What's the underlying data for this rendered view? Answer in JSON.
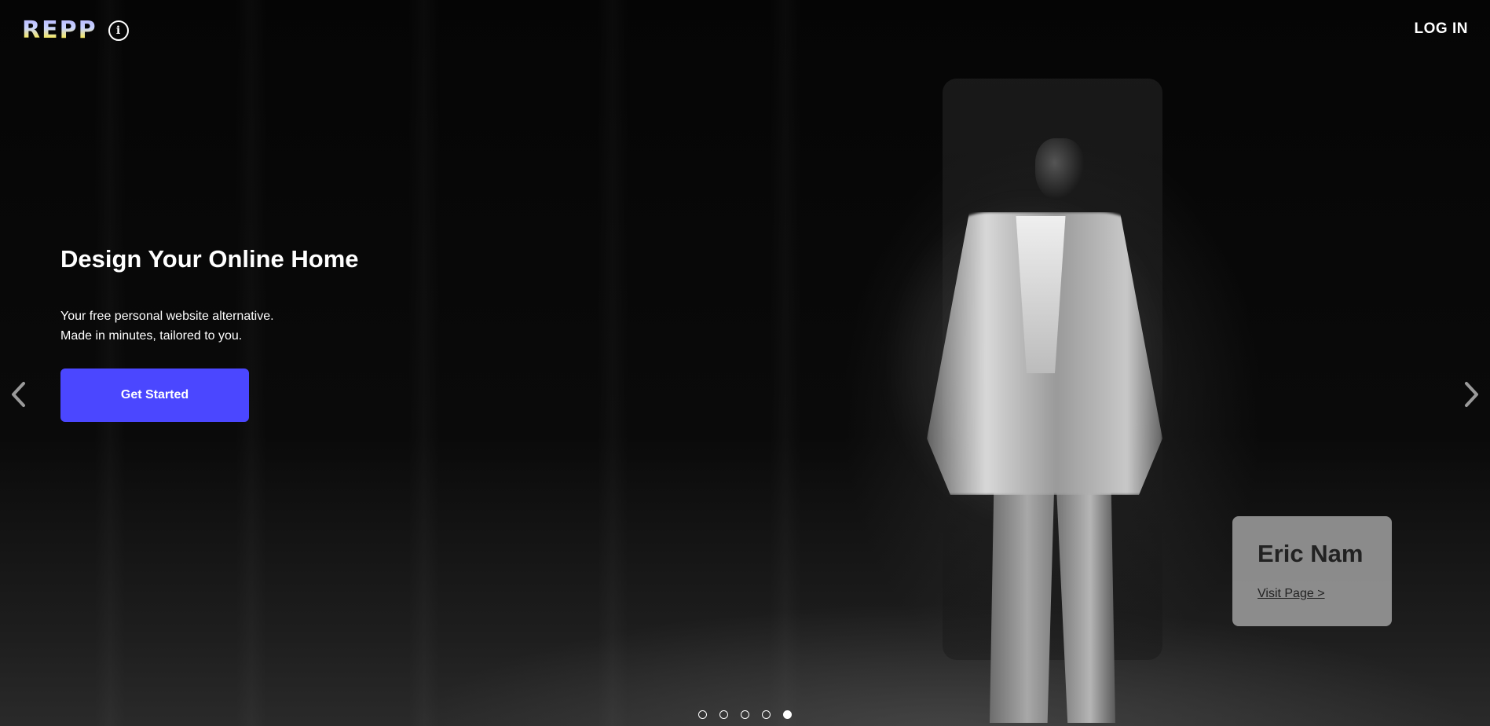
{
  "header": {
    "logo_text": "REPP",
    "info_icon": "info-circle-icon",
    "login_label": "LOG IN"
  },
  "hero": {
    "title": "Design Your Online Home",
    "subtitle_line1": "Your free personal website alternative.",
    "subtitle_line2": "Made in minutes, tailored to you.",
    "cta_label": "Get Started",
    "cta_color": "#4b47ff"
  },
  "carousel": {
    "prev_icon": "chevron-left-icon",
    "next_icon": "chevron-right-icon",
    "slide_count": 5,
    "active_slide": 5
  },
  "feature_card": {
    "name": "Eric Nam",
    "link_label": "Visit Page >"
  }
}
